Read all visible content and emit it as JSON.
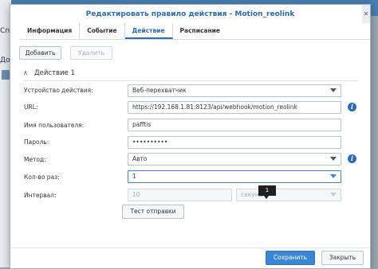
{
  "background": {
    "left_text_1": "Спи",
    "left_text_2": "До"
  },
  "dialog": {
    "title": "Редактировать правило действия - Motion_reolink",
    "tabs": [
      {
        "label": "Информация"
      },
      {
        "label": "Событие"
      },
      {
        "label": "Действие"
      },
      {
        "label": "Расписание"
      }
    ],
    "active_tab": "Действие",
    "toolbar": {
      "add_label": "Добавить",
      "delete_label": "Удалить"
    },
    "section": {
      "title": "Действие 1"
    },
    "form": {
      "device_label": "Устройство действия:",
      "device_value": "Веб-перехватчик",
      "url_label": "URL:",
      "url_value": "https://192.168.1.81:8123/api/webhook/motion_reolink",
      "username_label": "Имя пользователя:",
      "username_value": "pafftis",
      "password_label": "Пароль:",
      "password_value": "••••••••••",
      "method_label": "Метод:",
      "method_value": "Авто",
      "times_label": "Кол-во раз:",
      "times_value": "1",
      "interval_label": "Интервал:",
      "interval_value": "10",
      "interval_unit": "секунд",
      "test_button": "Тест отправки"
    },
    "tooltip_text": "1",
    "footer": {
      "save_label": "Сохранить",
      "close_label": "Закрыть"
    }
  },
  "colors": {
    "accent": "#2a6bb3",
    "primary_button": "#3b86d4"
  }
}
